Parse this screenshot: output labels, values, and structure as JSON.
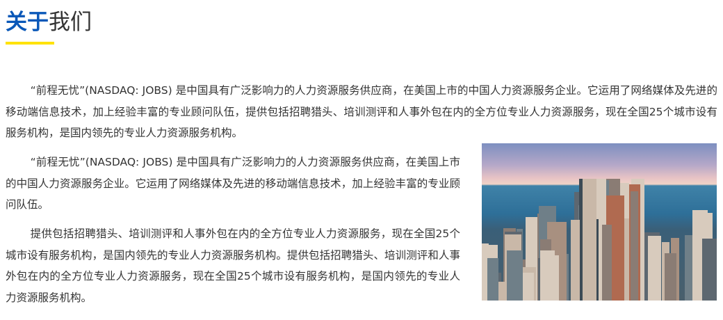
{
  "header": {
    "title_highlight": "关于",
    "title_rest": "我们",
    "accent_color": "#0a58b8",
    "underline_color": "#ffe200"
  },
  "paragraphs": [
    "“前程无忧”(NASDAQ: JOBS) 是中国具有广泛影响力的人力资源服务供应商，在美国上市的中国人力资源服务企业。它运用了网络媒体及先进的移动端信息技术，加上经验丰富的专业顾问队伍，提供包括招聘猎头、培训测评和人事外包在内的全方位专业人力资源服务，现在全国25个城市设有服务机构，是国内领先的专业人力资源服务机构。",
    "“前程无忧”(NASDAQ: JOBS) 是中国具有广泛影响力的人力资源服务供应商，在美国上市的中国人力资源服务企业。它运用了网络媒体及先进的移动端信息技术，加上经验丰富的专业顾问队伍。",
    "提供包括招聘猎头、培训测评和人事外包在内的全方位专业人力资源服务，现在全国25个城市设有服务机构，是国内领先的专业人力资源服务机构。提供包括招聘猎头、培训测评和人事外包在内的全方位专业人力资源服务，现在全国25个城市设有服务机构，是国内领先的专业人力资源服务机构。"
  ]
}
